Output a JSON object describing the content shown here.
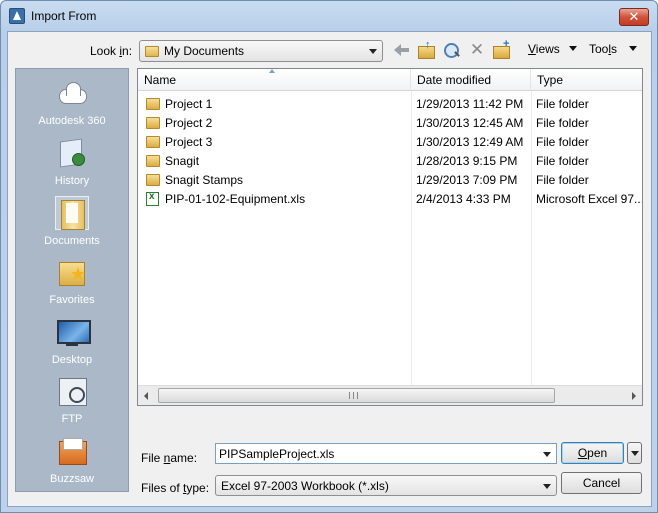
{
  "window": {
    "title": "Import From",
    "close_label": "✕"
  },
  "lookin": {
    "label": "Look in:",
    "value": "My Documents"
  },
  "toolbar": {
    "views_label": "Views",
    "tools_label": "Tools"
  },
  "places": [
    {
      "label": "Autodesk 360",
      "icon": "autodesk-360-icon"
    },
    {
      "label": "History",
      "icon": "history-icon"
    },
    {
      "label": "Documents",
      "icon": "documents-icon"
    },
    {
      "label": "Favorites",
      "icon": "favorites-icon"
    },
    {
      "label": "Desktop",
      "icon": "desktop-icon"
    },
    {
      "label": "FTP",
      "icon": "ftp-icon"
    },
    {
      "label": "Buzzsaw",
      "icon": "buzzsaw-icon"
    }
  ],
  "list": {
    "columns": {
      "name": "Name",
      "date": "Date modified",
      "type": "Type"
    },
    "rows": [
      {
        "name": "Project 1",
        "date": "1/29/2013 11:42 PM",
        "type": "File folder",
        "icon": "folder"
      },
      {
        "name": "Project 2",
        "date": "1/30/2013 12:45 AM",
        "type": "File folder",
        "icon": "folder"
      },
      {
        "name": "Project 3",
        "date": "1/30/2013 12:49 AM",
        "type": "File folder",
        "icon": "folder"
      },
      {
        "name": "Snagit",
        "date": "1/28/2013 9:15 PM",
        "type": "File folder",
        "icon": "folder"
      },
      {
        "name": "Snagit Stamps",
        "date": "1/29/2013 7:09 PM",
        "type": "File folder",
        "icon": "folder"
      },
      {
        "name": "PIP-01-102-Equipment.xls",
        "date": "2/4/2013 4:33 PM",
        "type": "Microsoft Excel 97...",
        "icon": "excel"
      }
    ]
  },
  "filename": {
    "label": "File name:",
    "value": "PIPSampleProject.xls"
  },
  "filetype": {
    "label": "Files of type:",
    "value": "Excel 97-2003 Workbook (*.xls)"
  },
  "buttons": {
    "open": "Open",
    "cancel": "Cancel"
  }
}
